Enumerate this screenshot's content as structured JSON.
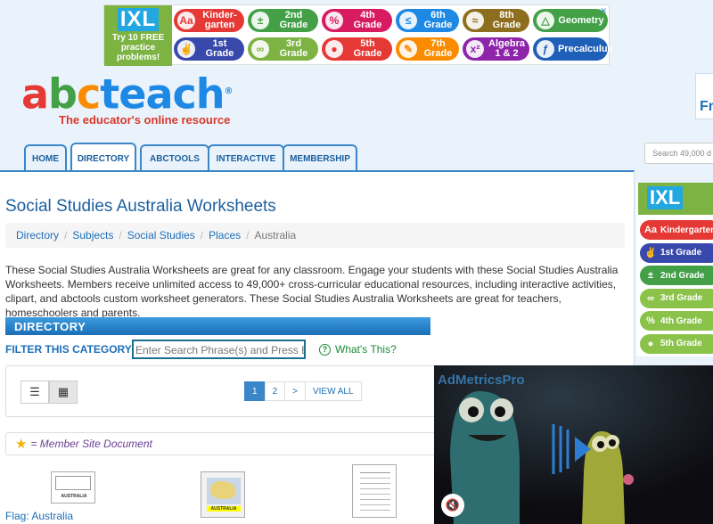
{
  "top_ad": {
    "ixl_logo": "IXL",
    "ixl_text": [
      "Try 10 FREE",
      "practice",
      "problems!"
    ],
    "close_icon": "x-icon",
    "grades": [
      {
        "label": "Kinder-\ngarten",
        "icon": "Aa",
        "color": "#e53935"
      },
      {
        "label": "2nd\nGrade",
        "icon": "±",
        "color": "#43a047"
      },
      {
        "label": "4th\nGrade",
        "icon": "%",
        "color": "#d81b60"
      },
      {
        "label": "6th\nGrade",
        "icon": "≤",
        "color": "#1e88e5"
      },
      {
        "label": "8th\nGrade",
        "icon": "≈",
        "color": "#8d6e1e"
      },
      {
        "label": "Geometry",
        "icon": "△",
        "color": "#43a047"
      },
      {
        "label": "1st\nGrade",
        "icon": "✌",
        "color": "#3949ab"
      },
      {
        "label": "3rd\nGrade",
        "icon": "∞",
        "color": "#7cb342"
      },
      {
        "label": "5th\nGrade",
        "icon": "●",
        "color": "#e53935"
      },
      {
        "label": "7th\nGrade",
        "icon": "✎",
        "color": "#fb8c00"
      },
      {
        "label": "Algebra\n1 & 2",
        "icon": "x²",
        "color": "#8e24aa"
      },
      {
        "label": "Precalculus",
        "icon": "ƒ",
        "color": "#1e5fb8"
      }
    ]
  },
  "logo": {
    "word": "abcteach",
    "registered": "®",
    "tagline": "The educator's online resource"
  },
  "side_box_text": "Fr",
  "nav": {
    "tabs": [
      "HOME",
      "DIRECTORY",
      "ABCTOOLS",
      "INTERACTIVE",
      "MEMBERSHIP"
    ],
    "active": "DIRECTORY"
  },
  "search": {
    "placeholder": "Search 49,000 d"
  },
  "main": {
    "title": "Social Studies Australia Worksheets",
    "breadcrumb": [
      "Directory",
      "Subjects",
      "Social Studies",
      "Places",
      "Australia"
    ],
    "intro": "These Social Studies Australia Worksheets are great for any classroom. Engage your students with these Social Studies Australia Worksheets. Members receive unlimited access to 49,000+ cross-curricular educational resources, including interactive activities, clipart, and abctools custom worksheet generators. These Social Studies Australia Worksheets are great for teachers, homeschoolers and parents.",
    "directory_label": "DIRECTORY",
    "filter_label": "FILTER THIS CATEGORY:",
    "filter_placeholder": "Enter Search Phrase(s) and Press Ente",
    "whats_this": "What's This?",
    "pager": [
      "1",
      "2",
      ">",
      "VIEW ALL"
    ],
    "member_note": "= Member Site Document",
    "items": [
      {
        "caption": "Flag: Australia",
        "thumb_text": "AUSTRALIA"
      },
      {
        "caption": "",
        "thumb_text": "AUSTRALIA"
      },
      {
        "caption": "",
        "thumb_text": ""
      }
    ]
  },
  "side_ad": {
    "logo": "IXL",
    "grades": [
      {
        "label": "Kindergarten",
        "icon": "Aa",
        "color": "#e53935"
      },
      {
        "label": "1st Grade",
        "icon": "✌",
        "color": "#3949ab"
      },
      {
        "label": "2nd Grade",
        "icon": "±",
        "color": "#43a047"
      },
      {
        "label": "3rd Grade",
        "icon": "∞",
        "color": "#8bc34a"
      },
      {
        "label": "4th Grade",
        "icon": "%",
        "color": "#8bc34a"
      },
      {
        "label": "5th Grade",
        "icon": "●",
        "color": "#8bc34a"
      }
    ]
  },
  "video": {
    "brand": "AdMetricsPro",
    "mute_icon": "muted-speaker-icon"
  }
}
